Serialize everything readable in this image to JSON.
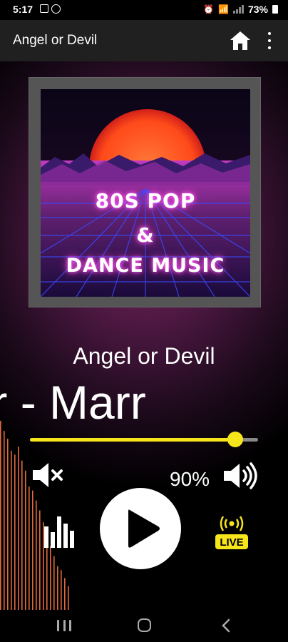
{
  "status": {
    "time": "5:17",
    "battery": "73%"
  },
  "app_bar": {
    "title": "Angel or Devil",
    "home_icon": "home-icon",
    "menu_icon": "more-vert-icon"
  },
  "album_art": {
    "line1": "80S POP",
    "line2": "&",
    "line3": "DANCE MUSIC",
    "glow_color": "#ff60ff",
    "sun_color": "#ff5a2a"
  },
  "now_playing": {
    "title": "Angel or Devil",
    "artist_scrolling": "cher - Marr"
  },
  "player": {
    "progress": 0.9,
    "volume_label": "90%",
    "accent_color": "#f7e51c",
    "live_label": "LIVE",
    "icons": [
      "volume-mute-icon",
      "volume-up-icon",
      "equalizer-icon",
      "play-icon",
      "live-broadcast-icon"
    ]
  },
  "visualizer": {
    "bar_color": "#e06a3c",
    "levels": [
      0.95,
      0.9,
      0.86,
      0.8,
      0.78,
      0.82,
      0.75,
      0.7,
      0.62,
      0.6,
      0.55,
      0.5,
      0.44,
      0.38,
      0.32,
      0.27,
      0.22,
      0.2,
      0.16,
      0.12
    ]
  },
  "nav_bar": {
    "icons": [
      "recents-icon",
      "home-circle-icon",
      "back-icon"
    ]
  }
}
